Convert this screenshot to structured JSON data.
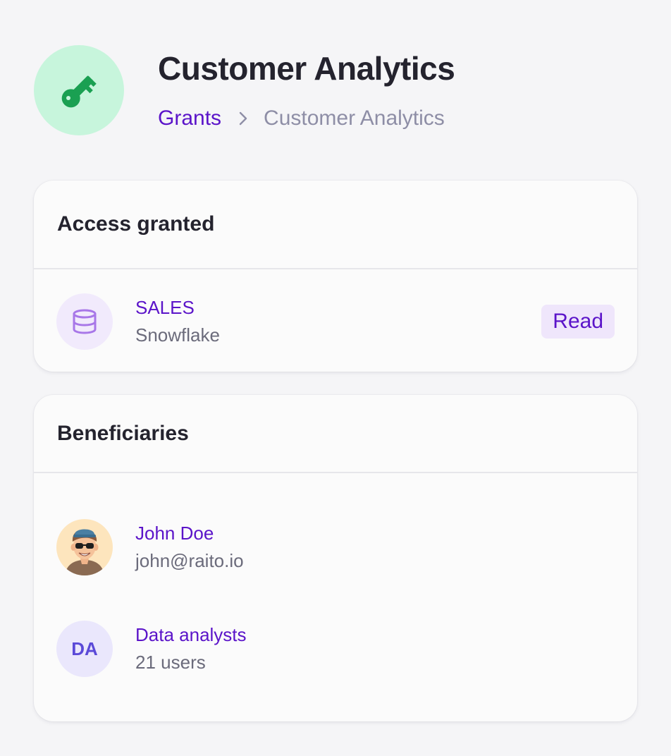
{
  "header": {
    "icon": "key-icon",
    "icon_bg": "#c7f5dc",
    "icon_color": "#1aa052",
    "title": "Customer Analytics",
    "breadcrumb": {
      "parent": "Grants",
      "current": "Customer Analytics"
    }
  },
  "access": {
    "title": "Access granted",
    "items": [
      {
        "icon": "database-icon",
        "name": "SALES",
        "source": "Snowflake",
        "permission": "Read"
      }
    ]
  },
  "beneficiaries": {
    "title": "Beneficiaries",
    "items": [
      {
        "avatar": "user-avatar-photo",
        "name": "John Doe",
        "detail": "john@raito.io"
      },
      {
        "avatar_initials": "DA",
        "name": "Data analysts",
        "detail": "21 users"
      }
    ]
  },
  "colors": {
    "accent": "#5b14c9",
    "background": "#f5f5f7",
    "card": "#fbfbfb",
    "badge_bg": "#efe6fb"
  }
}
